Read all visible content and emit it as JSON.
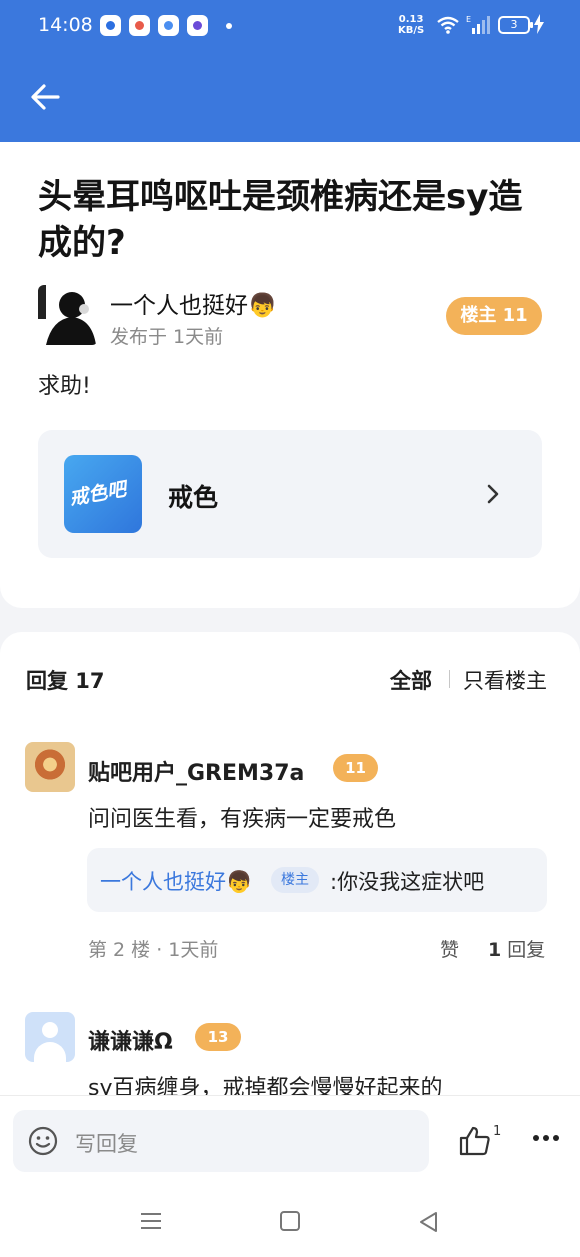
{
  "status_bar": {
    "time": "14:08",
    "net_speed_value": "0.13",
    "net_speed_unit": "KB/S",
    "battery": "3"
  },
  "post": {
    "title": "头晕耳鸣呕吐是颈椎病还是sy造成的?",
    "author": "一个人也挺好👦",
    "time": "发布于 1天前",
    "floor_badge": "楼主 11",
    "body": "求助!",
    "forum": {
      "name": "戒色",
      "logo_text": "戒色吧"
    }
  },
  "replies_header": {
    "count_label": "回复 17",
    "filter_all": "全部",
    "filter_op": "只看楼主"
  },
  "replies": [
    {
      "user": "贴吧用户_GREM37a",
      "level": "11",
      "text": "问问医生看，有疾病一定要戒色",
      "quote_name": "一个人也挺好👦",
      "quote_tag": "楼主",
      "quote_text": ":你没我这症状吧",
      "meta": "第 2 楼 · 1天前",
      "like_label": "赞",
      "reply_count": "1",
      "reply_label": "回复"
    },
    {
      "user": "谦谦谦Ω",
      "level": "13",
      "text": "sy百病缠身，戒掉都会慢慢好起来的"
    }
  ],
  "bottom_bar": {
    "placeholder": "写回复",
    "like_count": "1"
  },
  "colors": {
    "accent": "#3b78dd",
    "badge": "#f3b259"
  }
}
